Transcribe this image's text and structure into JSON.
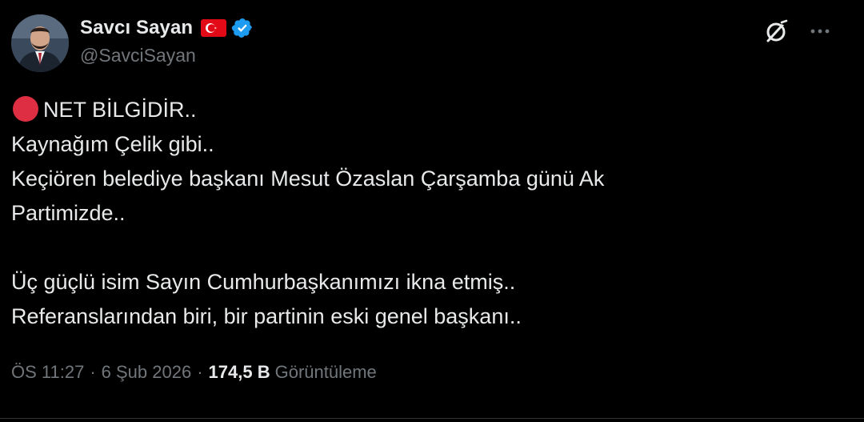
{
  "author": {
    "display_name": "Savcı Sayan",
    "handle": "@SavciSayan",
    "flag_icon": "turkey-flag-icon",
    "verified_icon": "verified-badge-icon",
    "verified_color": "#1d9bf0"
  },
  "tweet": {
    "lines": [
      "NET BİLGİDİR..",
      "Kaynağım Çelik gibi..",
      "Keçiören belediye başkanı Mesut Özaslan Çarşamba günü Ak",
      "Partimizde..",
      "",
      "Üç güçlü isim Sayın Cumhurbaşkanımızı ikna etmiş..",
      "Referanslarından biri, bir partinin eski genel başkanı.."
    ],
    "lead_emoji": "red-circle-icon",
    "lead_emoji_color": "#dd2e44"
  },
  "meta": {
    "time": "ÖS 11:27",
    "separator": "·",
    "date": "6 Şub 2026",
    "views_count": "174,5 B",
    "views_label": "Görüntüleme"
  },
  "actions": {
    "grok_icon": "grok-icon",
    "more_icon": "more-options-icon"
  },
  "colors": {
    "background": "#000000",
    "text": "#e7e9ea",
    "secondary": "#71767b"
  }
}
